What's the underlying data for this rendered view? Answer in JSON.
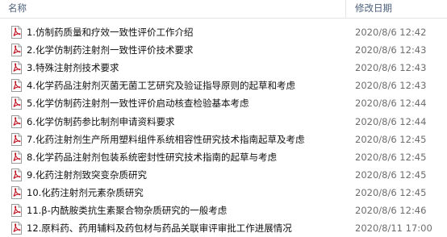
{
  "header": {
    "name_label": "名称",
    "date_label": "修改日期"
  },
  "colors": {
    "header_text": "#4c607a",
    "date_text": "#6d6d6d",
    "pdf_red": "#c1121f"
  },
  "files": [
    {
      "icon": "pdf-file-icon",
      "name": "1.仿制药质量和疗效一致性评价工作介绍",
      "date": "2020/8/6 12:42"
    },
    {
      "icon": "pdf-file-icon",
      "name": "2.化学仿制药注射剂一致性评价技术要求",
      "date": "2020/8/6 12:43"
    },
    {
      "icon": "pdf-file-icon",
      "name": "3.特殊注射剂技术要求",
      "date": "2020/8/6 12:43"
    },
    {
      "icon": "pdf-file-icon",
      "name": "4.化学药品注射剂灭菌无菌工艺研究及验证指导原则的起草和考虑",
      "date": "2020/8/6 12:43"
    },
    {
      "icon": "pdf-file-icon",
      "name": "5.化学仿制药注射剂一致性评价启动核查检验基本考虑",
      "date": "2020/8/6 12:44"
    },
    {
      "icon": "pdf-file-icon",
      "name": "6.化学仿制药参比制剂申请资料要求",
      "date": "2020/8/6 12:44"
    },
    {
      "icon": "pdf-file-icon",
      "name": "7.化药注射剂生产所用塑料组件系统相容性研究技术指南起草及考虑",
      "date": "2020/8/6 12:45"
    },
    {
      "icon": "pdf-file-icon",
      "name": "8.化学药品注射剂包装系统密封性研究技术指南的起草与考虑",
      "date": "2020/8/6 12:45"
    },
    {
      "icon": "pdf-file-icon",
      "name": "9.化药注射剂致突变杂质研究",
      "date": "2020/8/6 12:45"
    },
    {
      "icon": "pdf-file-icon",
      "name": "10.化药注射剂元素杂质研究",
      "date": "2020/8/6 12:45"
    },
    {
      "icon": "pdf-file-icon",
      "name": "11.β-内酰胺类抗生素聚合物杂质研究的一般考虑",
      "date": "2020/8/6 12:46"
    },
    {
      "icon": "pdf-file-icon",
      "name": "12.原料药、药用辅料及药包材与药品关联审评审批工作进展情况",
      "date": "2020/8/11 17:00"
    }
  ]
}
